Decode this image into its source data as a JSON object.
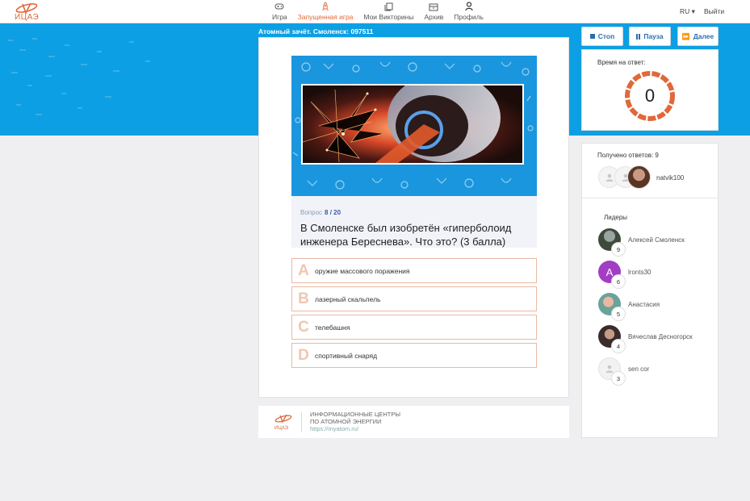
{
  "logo": {
    "text": "ИЦАЭ"
  },
  "nav": [
    {
      "label": "Игра",
      "icon": "gamepad-icon",
      "active": false
    },
    {
      "label": "Запущенная игра",
      "icon": "rocket-icon",
      "active": true
    },
    {
      "label": "Мои Викторины",
      "icon": "copy-icon",
      "active": false
    },
    {
      "label": "Архив",
      "icon": "archive-icon",
      "active": false
    },
    {
      "label": "Профиль",
      "icon": "user-icon",
      "active": false
    }
  ],
  "header_right": {
    "lang": "RU",
    "logout": "Выйти"
  },
  "quiz": {
    "title": "Атомный зачёт. Смоленск: 097511"
  },
  "controls": {
    "stop": "Стоп",
    "pause": "Пауза",
    "next": "Далее"
  },
  "question": {
    "label": "Вопрос",
    "number": "8 / 20",
    "text": "В Смоленске был изобретён «гиперболоид инженера Береснева». Что это? (3 балла)"
  },
  "answers": [
    {
      "letter": "A",
      "text": "оружие массового поражения"
    },
    {
      "letter": "B",
      "text": "лазерный скальпель"
    },
    {
      "letter": "C",
      "text": "телебашня"
    },
    {
      "letter": "D",
      "text": "спортивный снаряд"
    }
  ],
  "timer": {
    "label": "Время на ответ:",
    "value": "0"
  },
  "responses": {
    "label": "Получено ответов: 9",
    "user": "natvik100"
  },
  "leaders": {
    "title": "Лидеры",
    "items": [
      {
        "name": "Алексей  Смоленск",
        "score": "9",
        "avatar_color": "#4b5b47"
      },
      {
        "name": "lronts30",
        "score": "6",
        "avatar_color": "#a13ec4",
        "initial": "A"
      },
      {
        "name": "Анастасия",
        "score": "5",
        "avatar_color": "#7aa7a0"
      },
      {
        "name": "Вячеслав  Десногорск",
        "score": "4",
        "avatar_color": "#4c3b3b"
      },
      {
        "name": "sen  cor",
        "score": "3",
        "avatar_color": "#f0f0f0"
      }
    ]
  },
  "footer": {
    "line1": "ИНФОРМАЦИОННЫЕ ЦЕНТРЫ",
    "line2": "ПО АТОМНОЙ ЭНЕРГИИ",
    "link": "https://myatom.ru/"
  },
  "colors": {
    "accent": "#e0683a",
    "band": "#0d9fe3",
    "link": "#2a6fb0"
  }
}
